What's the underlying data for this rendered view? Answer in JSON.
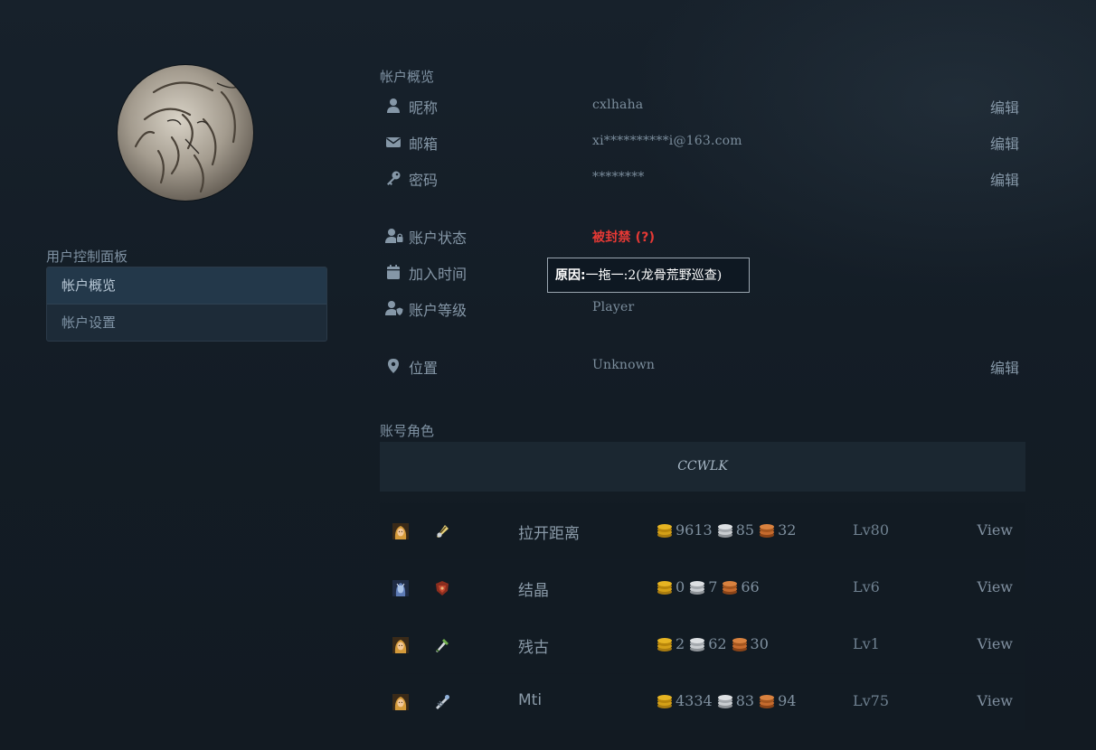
{
  "colors": {
    "banned": "#e53935",
    "gold": "#d4a017",
    "silver": "#c9cdd1",
    "copper": "#c66b2e"
  },
  "sidebar": {
    "heading": "用户控制面板",
    "items": [
      {
        "label": "帐户概览",
        "active": true
      },
      {
        "label": "帐户设置",
        "active": false
      }
    ]
  },
  "overview": {
    "title": "帐户概览",
    "edit_label": "编辑",
    "nickname": {
      "icon": "user-icon",
      "label": "昵称",
      "value": "cxlhaha"
    },
    "email": {
      "icon": "envelope-icon",
      "label": "邮箱",
      "value": "xi**********i@163.com"
    },
    "password": {
      "icon": "key-icon",
      "label": "密码",
      "value": "********"
    },
    "status": {
      "icon": "user-lock-icon",
      "label": "账户状态",
      "value": "被封禁 (?)"
    },
    "joined": {
      "icon": "calendar-icon",
      "label": "加入时间"
    },
    "rank": {
      "icon": "user-shield-icon",
      "label": "账户等级",
      "value": "Player"
    },
    "location": {
      "icon": "map-marker-icon",
      "label": "位置",
      "value": "Unknown"
    }
  },
  "tooltip": {
    "key": "原因:",
    "text": "一拖一:2(龙骨荒野巡查)"
  },
  "characters": {
    "title": "账号角色",
    "realm": "CCWLK",
    "view_label": "View",
    "rows": [
      {
        "race_icon": "human-female-race-icon",
        "class_icon": "hunter-class-icon",
        "name": "拉开距离",
        "gold": "9613",
        "silver": "85",
        "copper": "32",
        "level": "Lv80"
      },
      {
        "race_icon": "draenei-race-icon",
        "class_icon": "warrior-class-icon",
        "name": "结晶",
        "gold": "0",
        "silver": "7",
        "copper": "66",
        "level": "Lv6"
      },
      {
        "race_icon": "human-female-race-icon",
        "class_icon": "rogue-class-icon",
        "name": "残古",
        "gold": "2",
        "silver": "62",
        "copper": "30",
        "level": "Lv1"
      },
      {
        "race_icon": "human-female-race-icon",
        "class_icon": "mage-class-icon",
        "name": "Mti",
        "gold": "4334",
        "silver": "83",
        "copper": "94",
        "level": "Lv75"
      }
    ]
  }
}
